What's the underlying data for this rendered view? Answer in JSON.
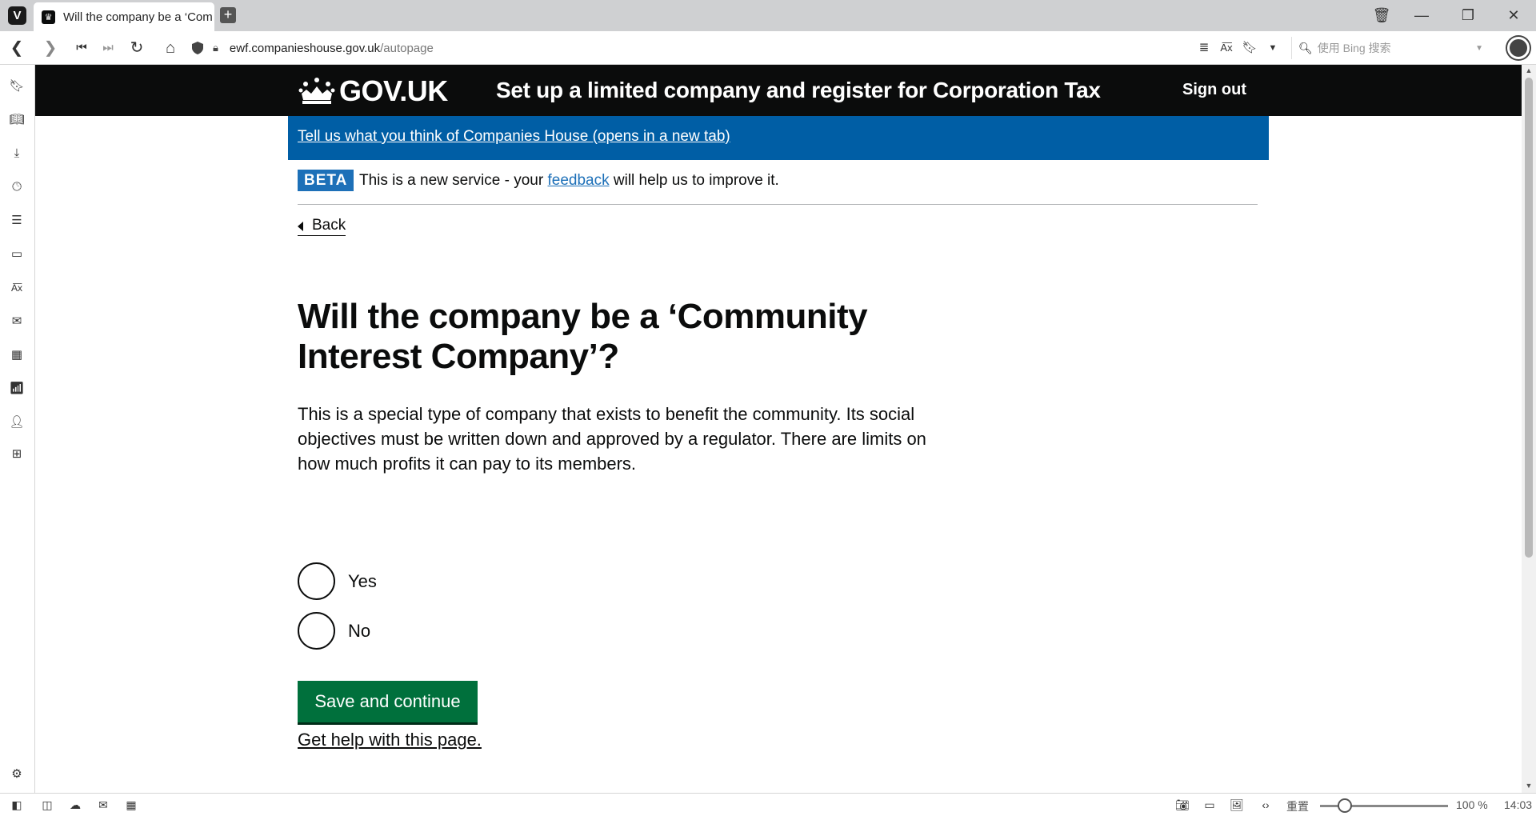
{
  "browser": {
    "tab_title": "Will the company be a ‘Com",
    "url_host": "ewf.companieshouse.gov.uk",
    "url_path": "/autopage",
    "search_placeholder": "使用 Bing 搜索",
    "zoom_label": "重置",
    "zoom_percent": "100 %",
    "clock": "14:03",
    "logo_letter": "V"
  },
  "header": {
    "logo_text": "GOV.UK",
    "service_name": "Set up a limited company and register for Corporation Tax",
    "sign_out": "Sign out"
  },
  "feedback_banner": {
    "link_text": "Tell us what you think of Companies House (opens in a new tab)"
  },
  "phase_banner": {
    "tag": "BETA",
    "text_before": "This is a new service - your ",
    "link": "feedback",
    "text_after": " will help us to improve it."
  },
  "back_link": "Back",
  "question": {
    "heading": "Will the company be a ‘Community Interest Company’?",
    "hint": "This is a special type of company that exists to benefit the community. Its social objectives must be written down and approved by a regulator. There are limits on how much profits it can pay to its members.",
    "options": [
      "Yes",
      "No"
    ]
  },
  "submit_label": "Save and continue",
  "help_link": "Get help with this page.",
  "colors": {
    "header_bg": "#0b0c0c",
    "banner_bg": "#005ea5",
    "beta_tag": "#1d70b8",
    "button_green": "#00703c"
  }
}
